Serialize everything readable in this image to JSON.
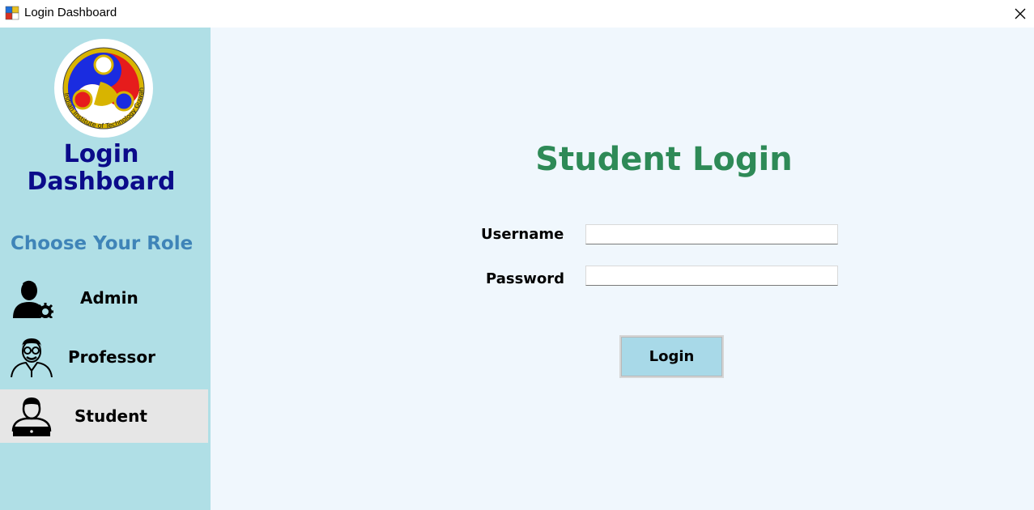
{
  "window": {
    "title": "Login Dashboard",
    "app_icon": "winforms-app-icon",
    "close_icon": "close-icon"
  },
  "sidebar": {
    "logo_alt": "Indian Institute of Technology Guwahati",
    "title_line1": "Login",
    "title_line2": "Dashboard",
    "role_heading": "Choose Your Role",
    "roles": [
      {
        "label": "Admin",
        "icon": "admin-user-gear-icon",
        "selected": false
      },
      {
        "label": "Professor",
        "icon": "professor-icon",
        "selected": false
      },
      {
        "label": "Student",
        "icon": "student-laptop-icon",
        "selected": true
      }
    ]
  },
  "main": {
    "title": "Student Login",
    "username_label": "Username",
    "username_value": "",
    "password_label": "Password",
    "password_value": "",
    "login_button": "Login"
  },
  "colors": {
    "sidebar_bg": "#b0dfe6",
    "main_bg": "#f0f7fd",
    "title_green": "#2e8a57",
    "navy": "#0b0b8a",
    "role_heading_blue": "#3f84b8",
    "selected_row": "#e6e6e6",
    "login_button_bg": "#a8d9e8"
  }
}
